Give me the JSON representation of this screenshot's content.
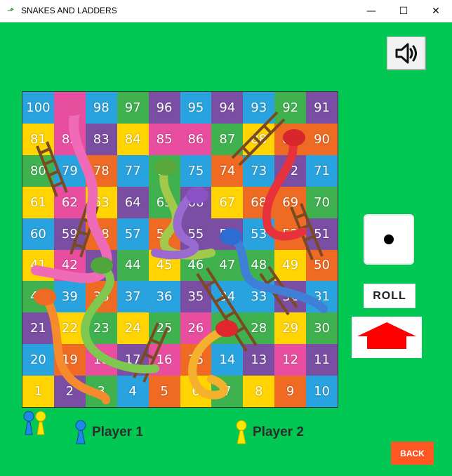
{
  "window": {
    "title": "SNAKES AND LADDERS",
    "minimize_icon": "minimize-icon",
    "maximize_icon": "maximize-icon",
    "close_icon": "close-icon"
  },
  "sound_button": {
    "icon": "speaker-icon"
  },
  "board": {
    "rows": [
      [
        100,
        99,
        98,
        97,
        96,
        95,
        94,
        93,
        92,
        91
      ],
      [
        81,
        82,
        83,
        84,
        85,
        86,
        87,
        88,
        89,
        90
      ],
      [
        80,
        79,
        78,
        77,
        76,
        75,
        74,
        73,
        72,
        71
      ],
      [
        61,
        62,
        63,
        64,
        65,
        66,
        67,
        68,
        69,
        70
      ],
      [
        60,
        59,
        58,
        57,
        56,
        55,
        54,
        53,
        52,
        51
      ],
      [
        41,
        42,
        43,
        44,
        45,
        46,
        47,
        48,
        49,
        50
      ],
      [
        40,
        39,
        38,
        37,
        36,
        35,
        34,
        33,
        32,
        31
      ],
      [
        21,
        22,
        23,
        24,
        25,
        26,
        27,
        28,
        29,
        30
      ],
      [
        20,
        19,
        18,
        17,
        16,
        15,
        14,
        13,
        12,
        11
      ],
      [
        1,
        2,
        3,
        4,
        5,
        6,
        7,
        8,
        9,
        10
      ]
    ],
    "colors": [
      "#29a3df",
      "#e84da0",
      "#7a4ea3",
      "#3fb24f",
      "#ffd400",
      "#ef6a22"
    ],
    "color_pattern": [
      [
        0,
        1,
        0,
        3,
        2,
        0,
        2,
        0,
        3,
        2
      ],
      [
        4,
        1,
        2,
        4,
        1,
        1,
        3,
        4,
        5,
        5
      ],
      [
        3,
        0,
        5,
        0,
        3,
        0,
        5,
        0,
        2,
        0
      ],
      [
        4,
        1,
        4,
        2,
        3,
        2,
        4,
        5,
        5,
        3
      ],
      [
        0,
        2,
        5,
        0,
        5,
        2,
        2,
        0,
        5,
        2
      ],
      [
        4,
        1,
        2,
        3,
        4,
        3,
        3,
        3,
        4,
        5
      ],
      [
        3,
        0,
        5,
        0,
        0,
        2,
        0,
        0,
        2,
        0
      ],
      [
        2,
        4,
        3,
        4,
        3,
        1,
        3,
        3,
        4,
        3
      ],
      [
        0,
        5,
        1,
        2,
        1,
        5,
        0,
        2,
        1,
        2
      ],
      [
        4,
        2,
        3,
        0,
        5,
        4,
        3,
        4,
        5,
        0
      ]
    ]
  },
  "dice": {
    "value": 1
  },
  "roll_button": {
    "label": "ROLL"
  },
  "move_button": {
    "icon": "up-arrow-icon",
    "color": "#ff0000"
  },
  "players": [
    {
      "label": "Player 1",
      "color": "#1e88e5",
      "icon": "pawn-icon"
    },
    {
      "label": "Player 2",
      "color": "#ffe600",
      "icon": "pawn-icon"
    }
  ],
  "back_button": {
    "label": "BACK",
    "color": "#ff5722"
  }
}
